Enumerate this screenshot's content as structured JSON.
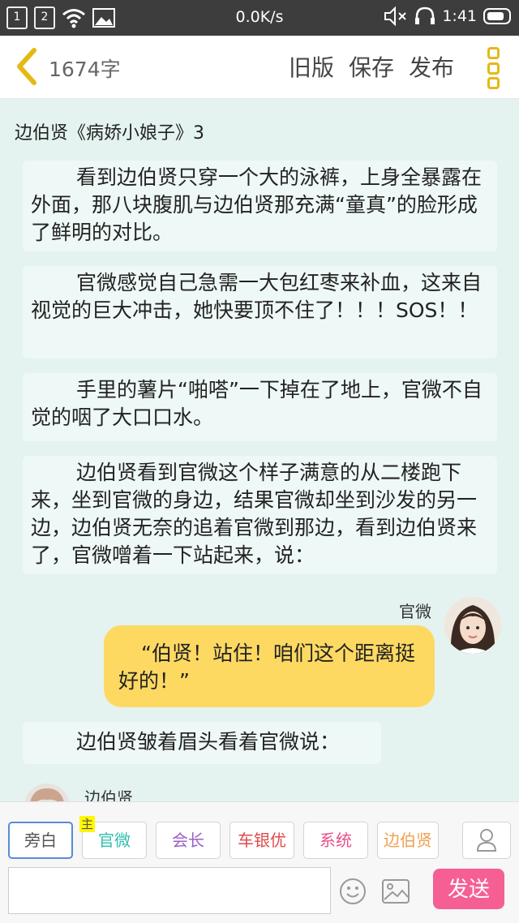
{
  "status": {
    "sim1": "1",
    "sim2": "2",
    "speed": "0.0K/s",
    "time": "1:41"
  },
  "header": {
    "word_count": "1674字",
    "actions": [
      "旧版",
      "保存",
      "发布"
    ]
  },
  "story": {
    "title": "边伯贤《病娇小娘子》3",
    "paragraphs": [
      "看到边伯贤只穿一个大的泳裤，上身全暴露在外面，那八块腹肌与边伯贤那充满“童真”的脸形成了鲜明的对比。",
      "官微感觉自己急需一大包红枣来补血，这来自视觉的巨大冲击，她快要顶不住了！！！SOS！！",
      "手里的薯片“啪嗒”一下掉在了地上，官微不自觉的咽了大口口水。",
      "边伯贤看到官微这个样子满意的从二楼跑下来，坐到官微的身边，结果官微却坐到沙发的另一边，边伯贤无奈的追着官微到那边，看到边伯贤来了，官微噌着一下站起来，说：",
      "边伯贤皱着眉头看着官微说："
    ],
    "dialogue": {
      "speaker": "官微",
      "text": "“伯贤！站住！咱们这个距离挺好的！”"
    },
    "next_speaker": "边伯贤"
  },
  "roles": {
    "host_badge": "主",
    "items": [
      {
        "label": "旁白",
        "color": "#555555"
      },
      {
        "label": "官微",
        "color": "#2fbfae"
      },
      {
        "label": "会长",
        "color": "#9b5fc8"
      },
      {
        "label": "车银优",
        "color": "#e04b4b"
      },
      {
        "label": "系统",
        "color": "#e8508a"
      },
      {
        "label": "边伯贤",
        "color": "#f0a050"
      }
    ]
  },
  "composer": {
    "input_value": "",
    "send_label": "发送"
  },
  "icons": [
    "back-chevron-icon",
    "more-menu-icon",
    "user-icon",
    "emoji-icon",
    "image-icon",
    "wifi-icon",
    "mute-icon",
    "headphone-icon",
    "battery-icon"
  ],
  "colors": {
    "background": "#e4f3ef",
    "accent_yellow": "#e5b914",
    "bubble": "#fdd962",
    "send": "#f55f94"
  }
}
